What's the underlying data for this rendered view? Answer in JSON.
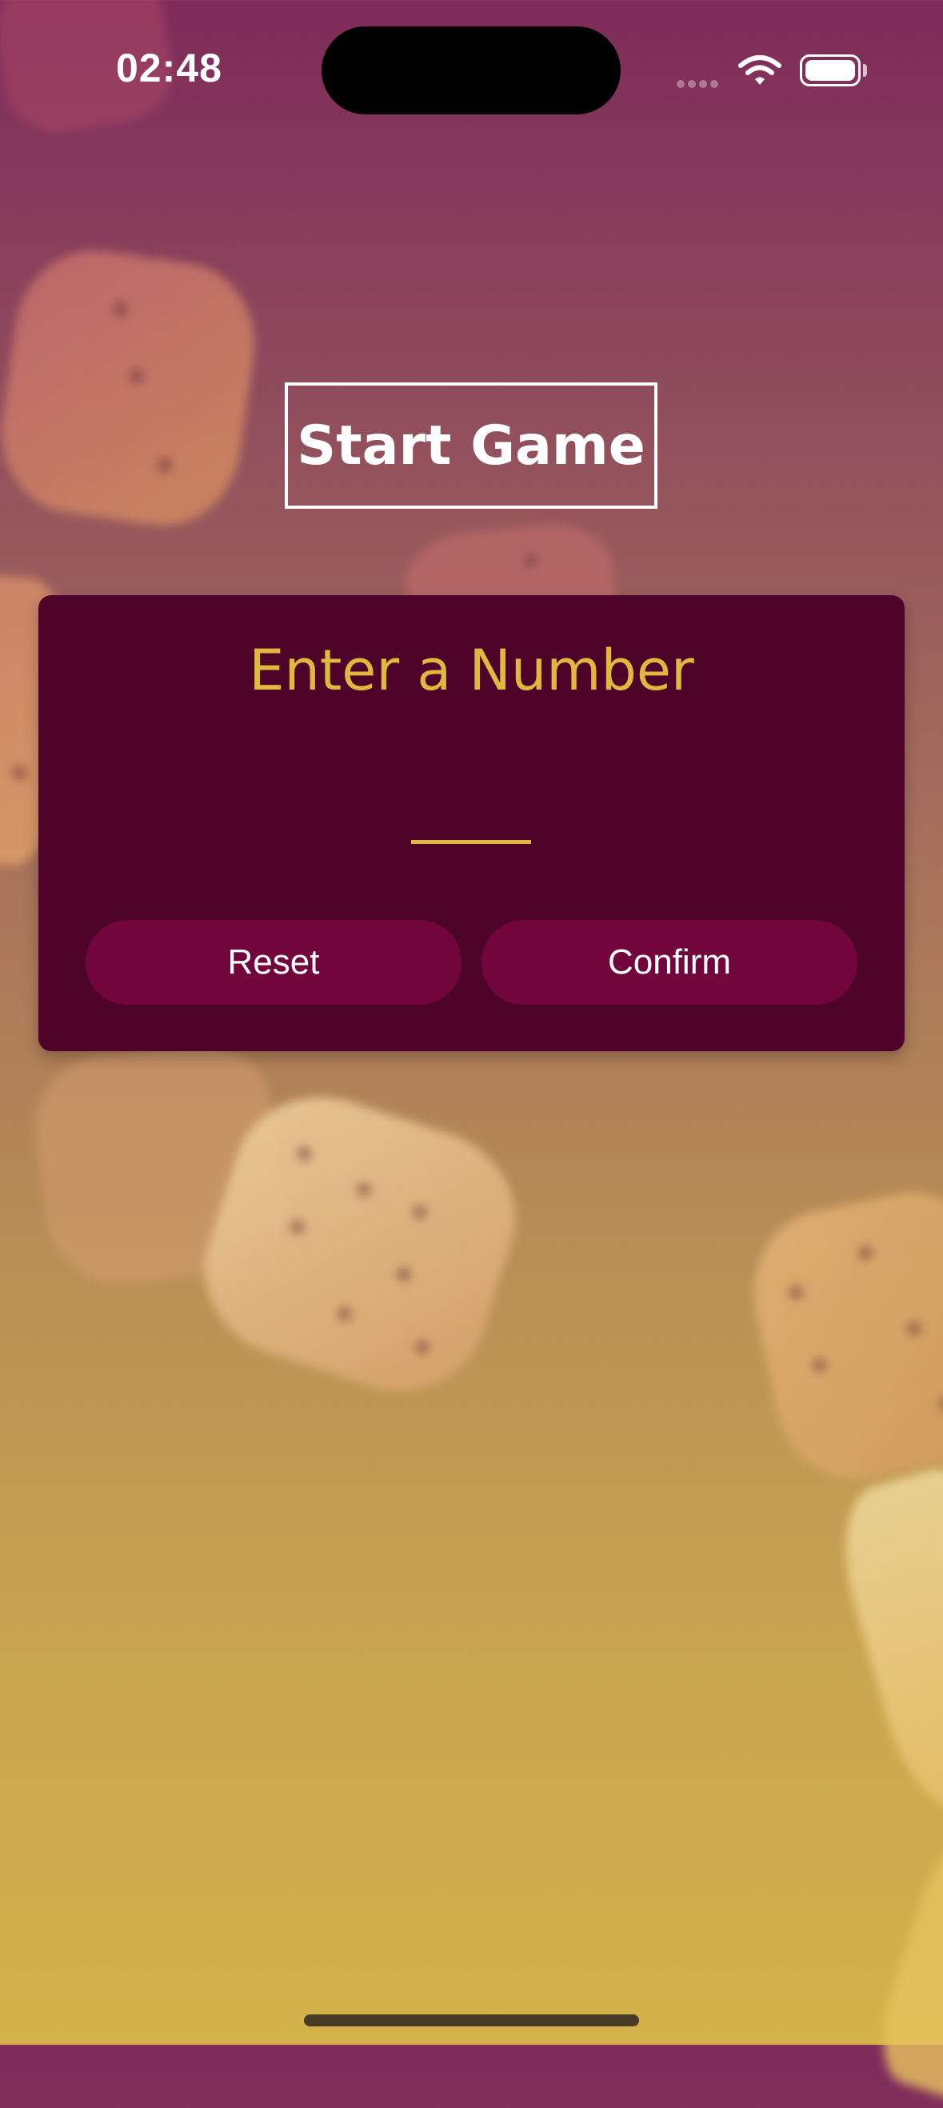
{
  "status_bar": {
    "time": "02:48"
  },
  "title": "Start Game",
  "card": {
    "title": "Enter a Number",
    "input_value": "",
    "reset_label": "Reset",
    "confirm_label": "Confirm"
  },
  "colors": {
    "card_background": "#4e0329",
    "button_background": "#72063c",
    "accent": "#e0b83e",
    "text_light": "#ffffff"
  },
  "icons": {
    "signal": "cellular-signal-icon",
    "wifi": "wifi-icon",
    "battery": "battery-icon"
  }
}
